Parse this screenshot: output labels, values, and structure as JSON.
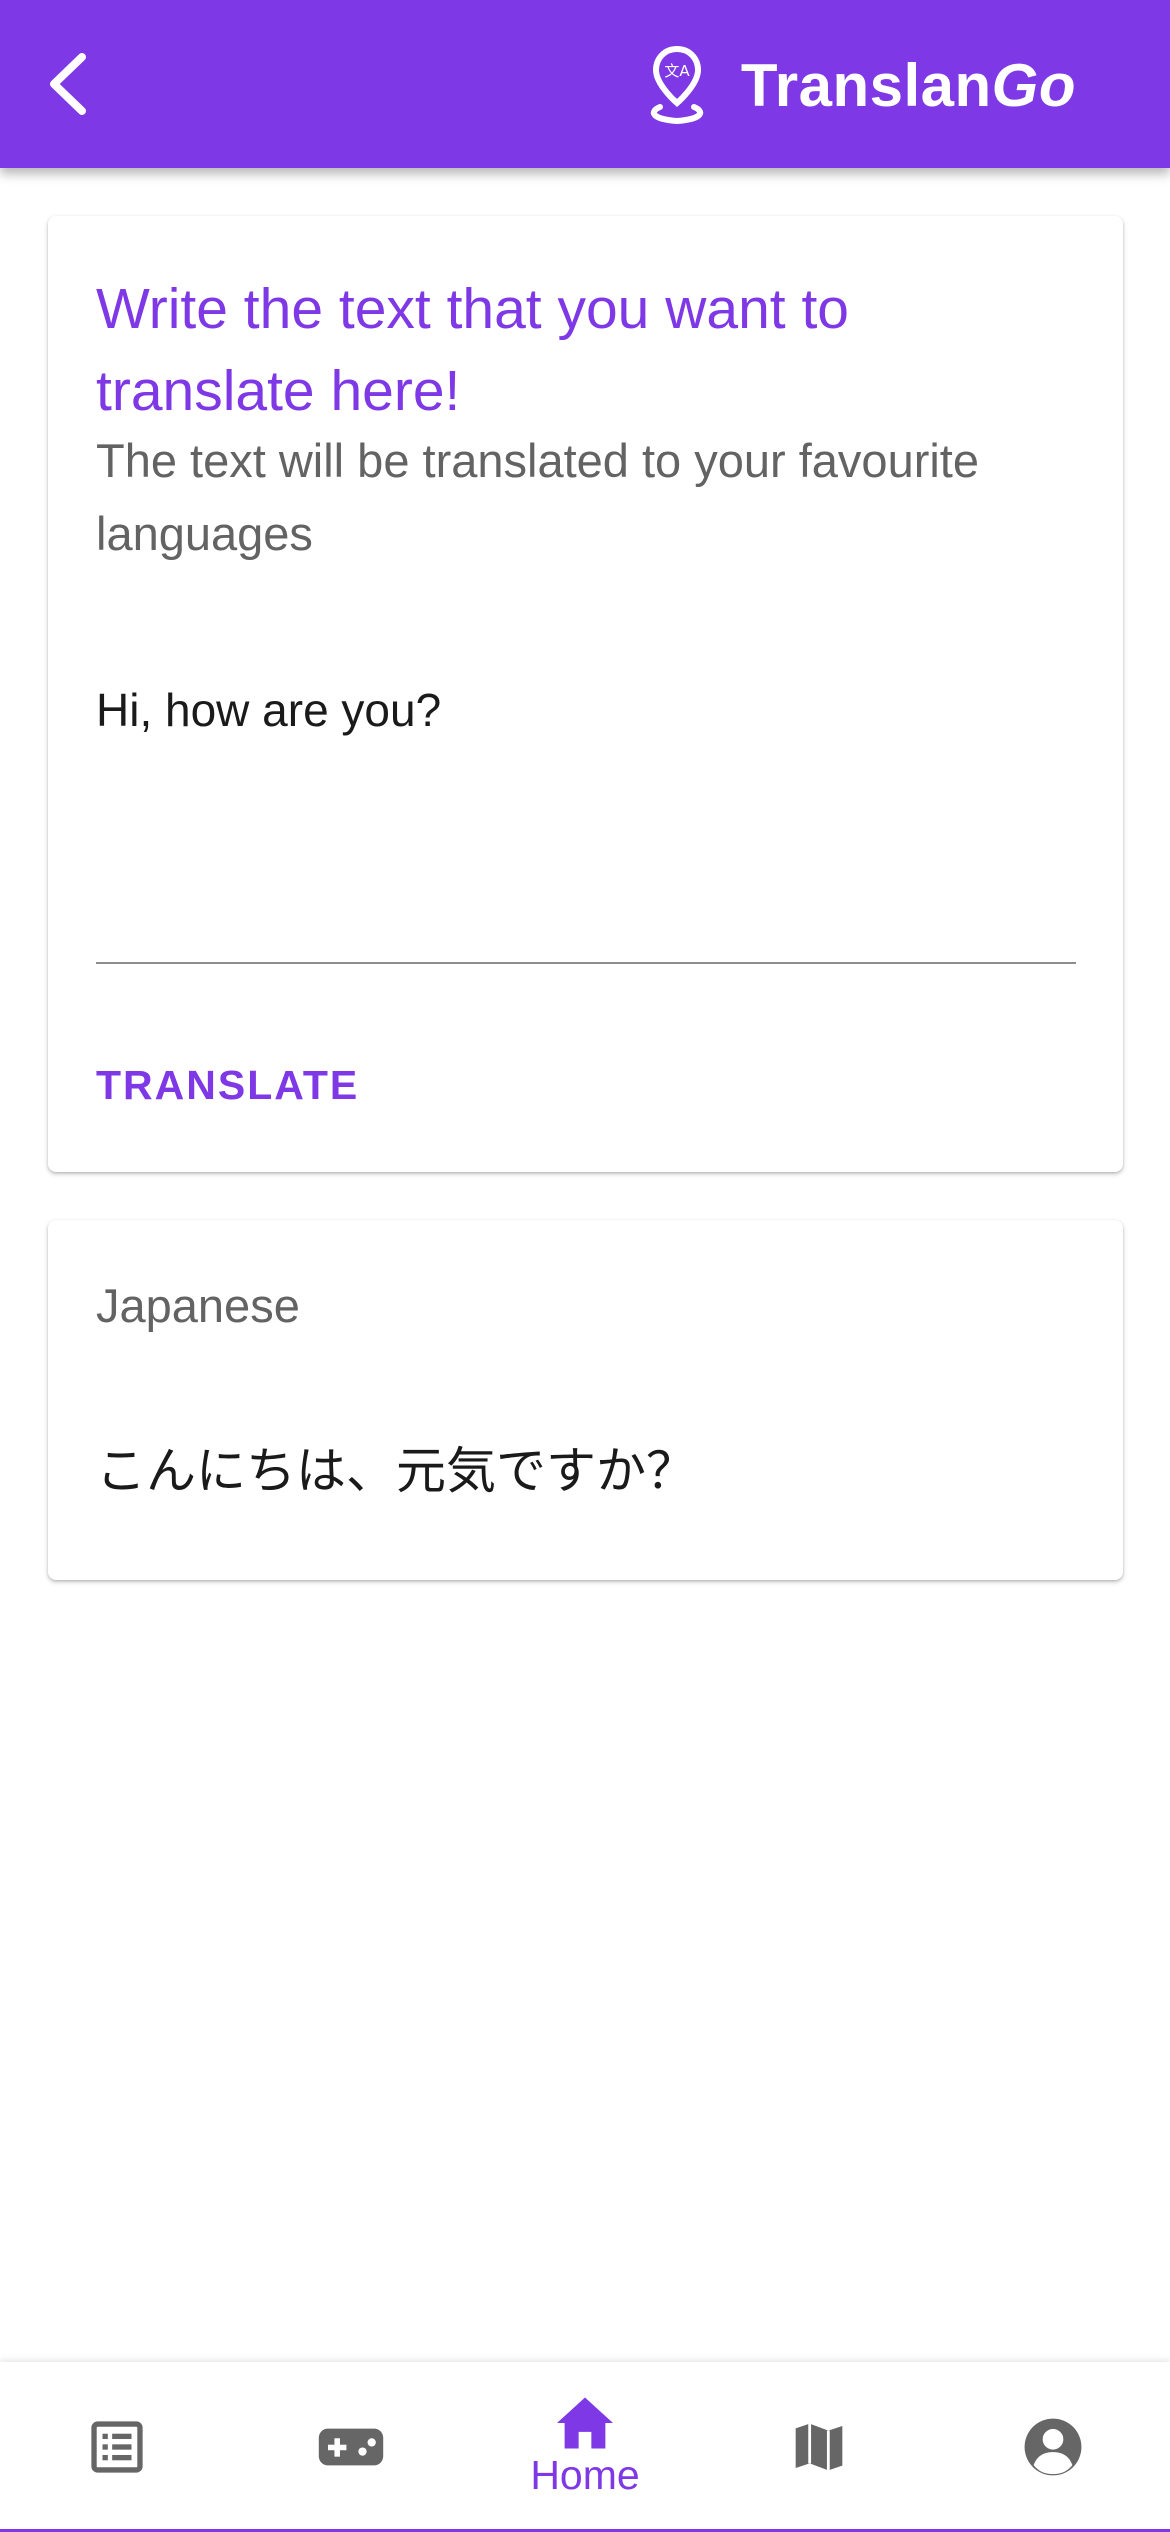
{
  "app_bar": {
    "title_main": "Translan",
    "title_accent": "Go",
    "back_icon": "chevron-left-icon",
    "logo_icon": "location-translate-icon",
    "color": "#7e38e6"
  },
  "input_card": {
    "heading": "Write the text that you want to translate here!",
    "subheading": "The text will be translated to your favourite languages",
    "input_value": "Hi, how are you?",
    "translate_label": "TRANSLATE"
  },
  "result_card": {
    "language": "Japanese",
    "translation": "こんにちは、元気ですか？"
  },
  "bottom_nav": {
    "items": [
      {
        "icon": "list-icon",
        "label": ""
      },
      {
        "icon": "gamepad-icon",
        "label": ""
      },
      {
        "icon": "home-icon",
        "label": "Home",
        "active": true
      },
      {
        "icon": "map-icon",
        "label": ""
      },
      {
        "icon": "account-icon",
        "label": ""
      }
    ],
    "active_color": "#7e38e6",
    "inactive_color": "#666666"
  }
}
